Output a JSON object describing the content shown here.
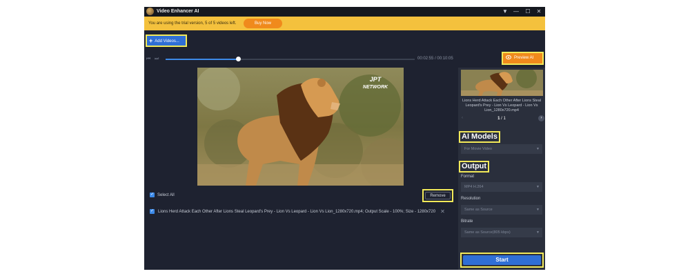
{
  "app": {
    "title": "Video Enhancer AI",
    "window_controls": [
      "▼",
      "—",
      "☐",
      "✕"
    ]
  },
  "trial_bar": {
    "message": "You are using the trial version, 5 of 5 videos left.",
    "buy_label": "Buy Now"
  },
  "toolbar": {
    "add_videos_label": "Add Videos...",
    "preview_label": "Preview AI"
  },
  "timeline": {
    "current": "00:02:55",
    "total": "00:10:05",
    "time_text": "00:02:55 / 00:10:05",
    "progress": 0.29
  },
  "video": {
    "watermark_line1": "JPT",
    "watermark_line2": "NETWORK"
  },
  "list": {
    "select_all_label": "Select All",
    "remove_label": "Remove",
    "file_entry": "Lions Herd Attack Each Other After Lions Steal Leopard's Prey - Lion Vs Leopard - Lion Vs Lion_1280x720.mp4; Output Scale - 100%; Size - 1280x720"
  },
  "side": {
    "thumb_name": "Lions Herd Attack Each Other After Lions Steal Leopard's Prey - Lion Vs Leopard - Lion Vs Lion_1280x720.mp4",
    "page_current": "1",
    "page_sep": "/ 1",
    "ai_models_title": "AI Models",
    "ai_model_value": "For Movie Video",
    "output_title": "Output",
    "format_label": "Format",
    "format_value": "MP4 H.264",
    "resolution_label": "Resolution",
    "resolution_value": "Same as Source",
    "bitrate_label": "Bitrate",
    "bitrate_value": "Same as Source(805 kbps)",
    "start_label": "Start"
  },
  "colors": {
    "accent_blue": "#2f6fd6",
    "accent_orange": "#f08a1c",
    "trial_yellow": "#f4c13d",
    "highlight": "#f3ea59",
    "window_bg": "#1e2230"
  }
}
